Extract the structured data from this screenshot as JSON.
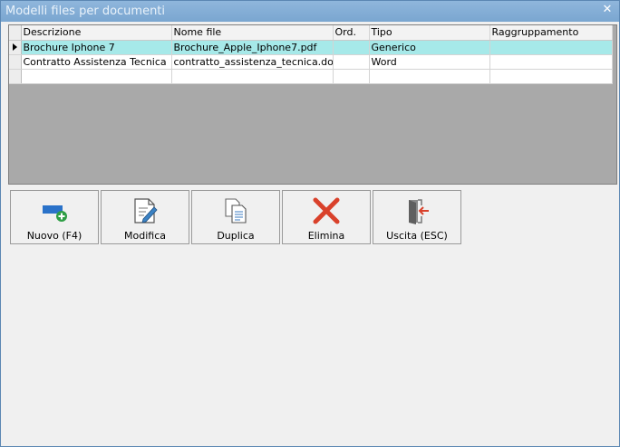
{
  "window": {
    "title": "Modelli files per documenti"
  },
  "grid": {
    "columns": [
      "Descrizione",
      "Nome file",
      "Ord.",
      "Tipo",
      "Raggruppamento"
    ],
    "rows": [
      {
        "descrizione": "Brochure Iphone 7",
        "nome_file": "Brochure_Apple_Iphone7.pdf",
        "ord": "",
        "tipo": "Generico",
        "raggruppamento": ""
      },
      {
        "descrizione": "Contratto Assistenza Tecnica",
        "nome_file": "contratto_assistenza_tecnica.doc",
        "ord": "",
        "tipo": "Word",
        "raggruppamento": ""
      }
    ]
  },
  "toolbar": {
    "nuovo": "Nuovo (F4)",
    "modifica": "Modifica",
    "duplica": "Duplica",
    "elimina": "Elimina",
    "uscita": "Uscita (ESC)"
  },
  "icons": {
    "nuovo": "add-icon",
    "modifica": "edit-document-icon",
    "duplica": "copy-document-icon",
    "elimina": "delete-x-icon",
    "uscita": "exit-door-icon",
    "close": "close-icon"
  },
  "colors": {
    "titlebar": "#7aa6d0",
    "selected_row": "#a6e9e9",
    "delete": "#d9412b"
  }
}
